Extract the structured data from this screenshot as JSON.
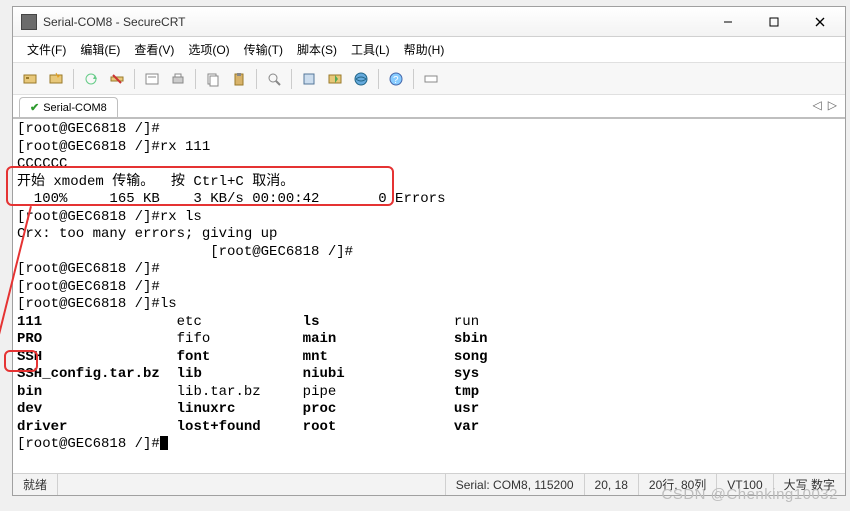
{
  "window": {
    "title": "Serial-COM8 - SecureCRT"
  },
  "menu": {
    "file": "文件(F)",
    "edit": "编辑(E)",
    "view": "查看(V)",
    "options": "选项(O)",
    "transfer": "传输(T)",
    "script": "脚本(S)",
    "tools": "工具(L)",
    "help": "帮助(H)"
  },
  "tab": {
    "label": "Serial-COM8"
  },
  "terminal": {
    "l1": "[root@GEC6818 /]#",
    "l2": "[root@GEC6818 /]#rx 111",
    "l3": "CCCCCC",
    "l4": "开始 xmodem 传输。  按 Ctrl+C 取消。",
    "l5": "  100%     165 KB    3 KB/s 00:00:42       0 Errors",
    "l6": "",
    "l7": "[root@GEC6818 /]#rx ls",
    "l8": "Crx: too many errors; giving up",
    "l9": "                       [root@GEC6818 /]#",
    "l10": "",
    "l11": "[root@GEC6818 /]#",
    "l12": "[root@GEC6818 /]#",
    "l13": "[root@GEC6818 /]#ls",
    "ls_rows": [
      {
        "c1": "111",
        "c2": "etc",
        "c3": "ls",
        "c4": "run",
        "bold": [
          0,
          2
        ]
      },
      {
        "c1": "PRO",
        "c2": "fifo",
        "c3": "main",
        "c4": "sbin",
        "bold": [
          0,
          2,
          3
        ]
      },
      {
        "c1": "SSH",
        "c2": "font",
        "c3": "mnt",
        "c4": "song",
        "bold": [
          0,
          1,
          2,
          3
        ]
      },
      {
        "c1": "SSH_config.tar.bz",
        "c2": "lib",
        "c3": "niubi",
        "c4": "sys",
        "bold": [
          0,
          1,
          2,
          3
        ]
      },
      {
        "c1": "bin",
        "c2": "lib.tar.bz",
        "c3": "pipe",
        "c4": "tmp",
        "bold": [
          0,
          3
        ]
      },
      {
        "c1": "dev",
        "c2": "linuxrc",
        "c3": "proc",
        "c4": "usr",
        "bold": [
          0,
          1,
          2,
          3
        ]
      },
      {
        "c1": "driver",
        "c2": "lost+found",
        "c3": "root",
        "c4": "var",
        "bold": [
          0,
          1,
          2,
          3
        ]
      }
    ],
    "prompt_end": "[root@GEC6818 /]#"
  },
  "status": {
    "ready": "就绪",
    "conn": "Serial: COM8, 115200",
    "pos": "20, 18",
    "size": "20行, 80列",
    "emu": "VT100",
    "caps": "大写  数字"
  },
  "watermark": "CSDN @Chenking10032"
}
